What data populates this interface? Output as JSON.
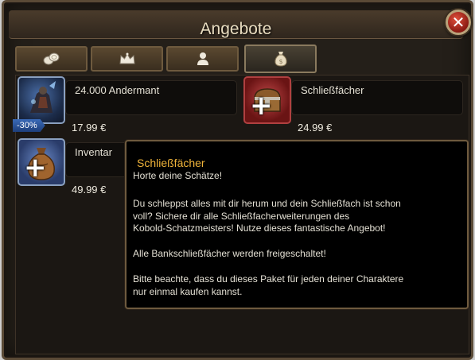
{
  "window": {
    "title": "Angebote"
  },
  "tabs": [
    {
      "icon": "coins-icon"
    },
    {
      "icon": "crown-icon"
    },
    {
      "icon": "person-icon"
    },
    {
      "icon": "money-bag-icon",
      "active": true
    }
  ],
  "items": [
    {
      "name": "24.000  Andermant",
      "price": "17.99  €",
      "badge": "-30%",
      "icon": "andermant-icon"
    },
    {
      "name": "Schließfächer",
      "price": "24.99  €",
      "icon": "chest-icon"
    },
    {
      "name": "Inventar",
      "price": "49.99  €",
      "icon": "bag-icon"
    }
  ],
  "tooltip": {
    "title": "Schließfächer",
    "lines": [
      "Horte deine Schätze!",
      "Du schleppst alles mit dir herum und dein Schließfach ist schon",
      "voll? Sichere dir alle Schließfacherweiterungen des",
      "Kobold-Schatzmeisters! Nutze dieses fantastische Angebot!",
      "Alle Bankschließfächer werden freigeschaltet!",
      "Bitte beachte, dass du dieses Paket für jeden deiner Charaktere",
      "nur einmal kaufen kannst."
    ]
  },
  "colors": {
    "tooltip_title": "#f0b43a",
    "discount_badge": "#2e5aa8",
    "close_button": "#c0392b"
  }
}
